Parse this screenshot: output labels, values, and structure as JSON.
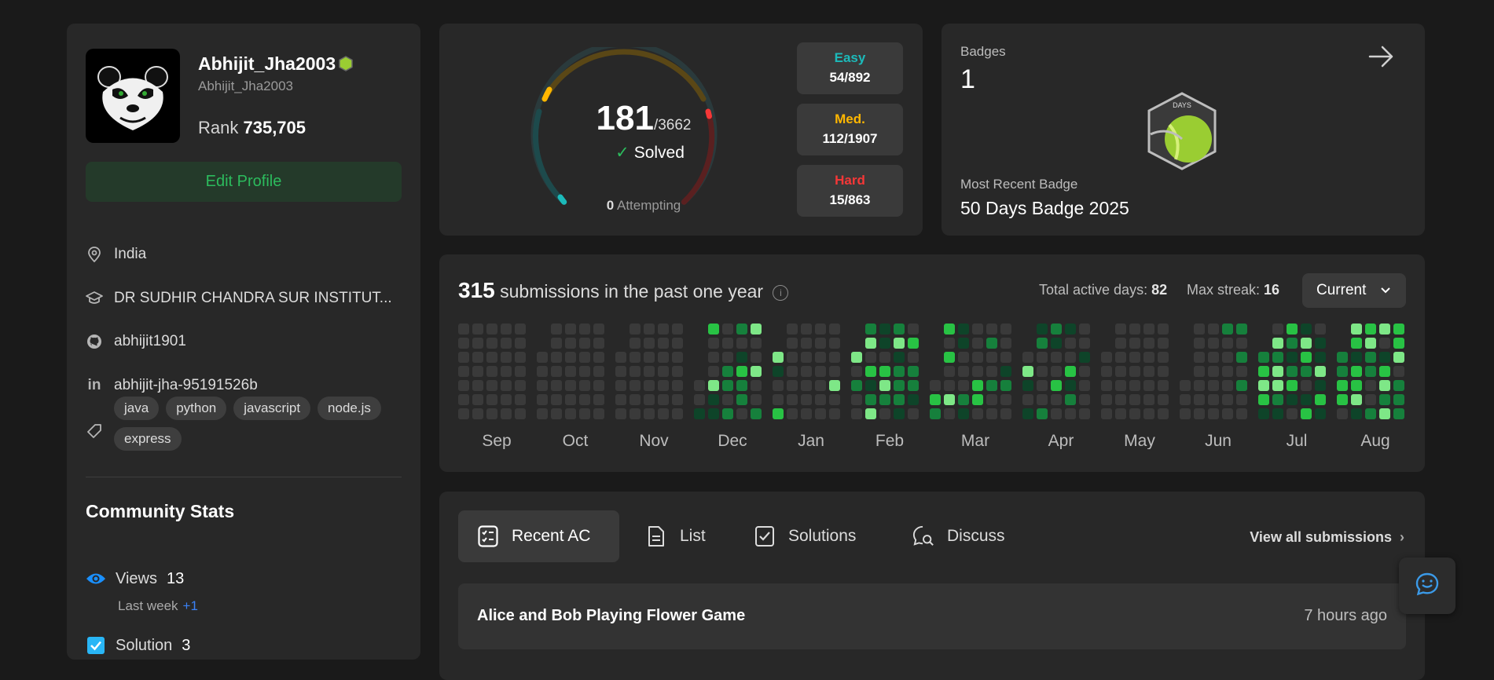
{
  "profile": {
    "username": "Abhijit_Jha2003",
    "handle": "Abhijit_Jha2003",
    "rank_label": "Rank",
    "rank_value": "735,705",
    "edit_label": "Edit Profile",
    "location": "India",
    "school": "DR SUDHIR CHANDRA SUR INSTITUT...",
    "github": "abhijit1901",
    "linkedin": "abhijit-jha-95191526b",
    "skills": [
      "java",
      "python",
      "javascript",
      "node.js",
      "express"
    ]
  },
  "community": {
    "title": "Community Stats",
    "views_label": "Views",
    "views_value": "13",
    "views_lastweek_label": "Last week",
    "views_lastweek_value": "+1",
    "solution_label": "Solution",
    "solution_value": "3"
  },
  "solved": {
    "count": "181",
    "total": "/3662",
    "label": "Solved",
    "attempting_count": "0",
    "attempting_label": "Attempting",
    "easy_label": "Easy",
    "easy_value": "54/892",
    "med_label": "Med.",
    "med_value": "112/1907",
    "hard_label": "Hard",
    "hard_value": "15/863",
    "colors": {
      "easy": "#1cbaba",
      "medium": "#ffb700",
      "hard": "#f63737"
    }
  },
  "badges": {
    "title": "Badges",
    "count": "1",
    "recent_label": "Most Recent Badge",
    "recent_name": "50 Days Badge 2025",
    "badge_text": "DAYS"
  },
  "heatmap": {
    "submissions": "315",
    "submissions_label": "submissions in the past one year",
    "active_label": "Total active days:",
    "active_value": "82",
    "streak_label": "Max streak:",
    "streak_value": "16",
    "select_value": "Current",
    "months": [
      "Sep",
      "Oct",
      "Nov",
      "Dec",
      "Jan",
      "Feb",
      "Mar",
      "Apr",
      "May",
      "Jun",
      "Jul",
      "Aug"
    ]
  },
  "tabs": {
    "items": [
      "Recent AC",
      "List",
      "Solutions",
      "Discuss"
    ],
    "view_all": "View all submissions"
  },
  "recent": [
    {
      "title": "Alice and Bob Playing Flower Game",
      "time": "7 hours ago"
    }
  ]
}
